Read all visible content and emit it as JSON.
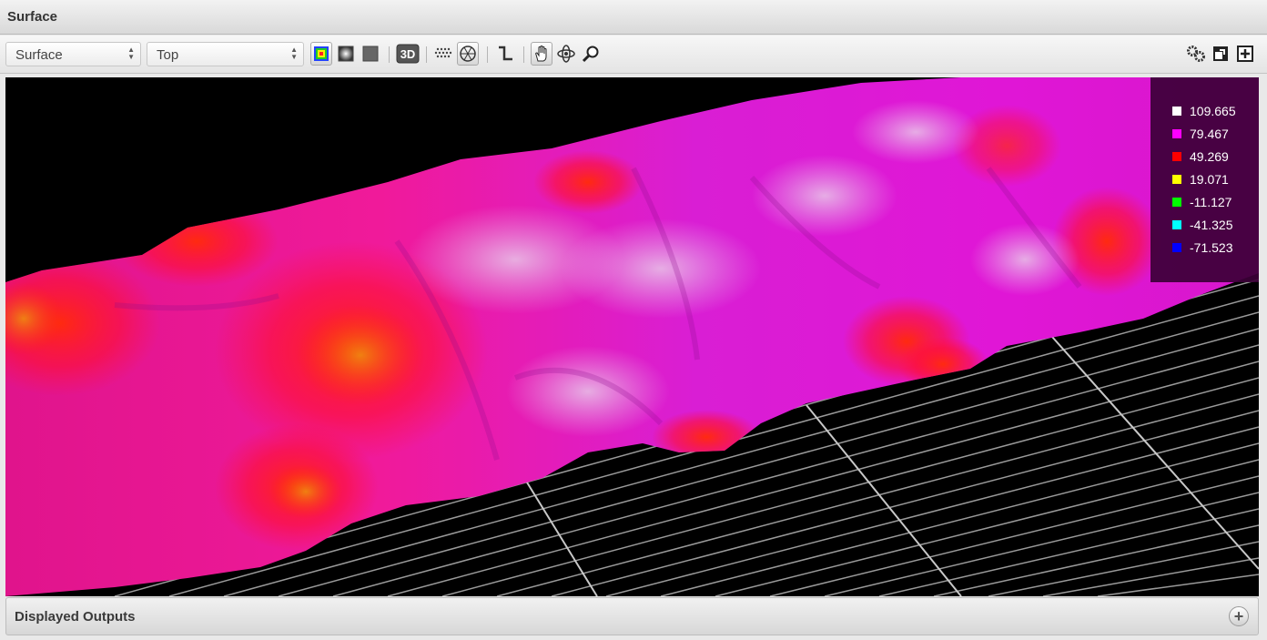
{
  "window": {
    "title": "Surface"
  },
  "toolbar": {
    "view_select": {
      "value": "Surface"
    },
    "orientation_select": {
      "value": "Top"
    },
    "mode_3d_label": "3D"
  },
  "legend": {
    "items": [
      {
        "label": "109.665",
        "color": "#ffffff"
      },
      {
        "label": "79.467",
        "color": "#ff00ff"
      },
      {
        "label": "49.269",
        "color": "#ff0000"
      },
      {
        "label": "19.071",
        "color": "#ffff00"
      },
      {
        "label": "-11.127",
        "color": "#00ff00"
      },
      {
        "label": "-41.325",
        "color": "#00ffff"
      },
      {
        "label": "-71.523",
        "color": "#0000ff"
      }
    ]
  },
  "footer": {
    "label": "Displayed Outputs"
  },
  "icons": [
    "color-map-icon",
    "gradient-icon",
    "solid-icon",
    "3d-icon",
    "mesh-icon",
    "wireframe-icon",
    "profile-icon",
    "pan-icon",
    "rotate-icon",
    "zoom-icon",
    "settings-icon",
    "window-icon",
    "add-panel-icon",
    "expand-icon"
  ]
}
